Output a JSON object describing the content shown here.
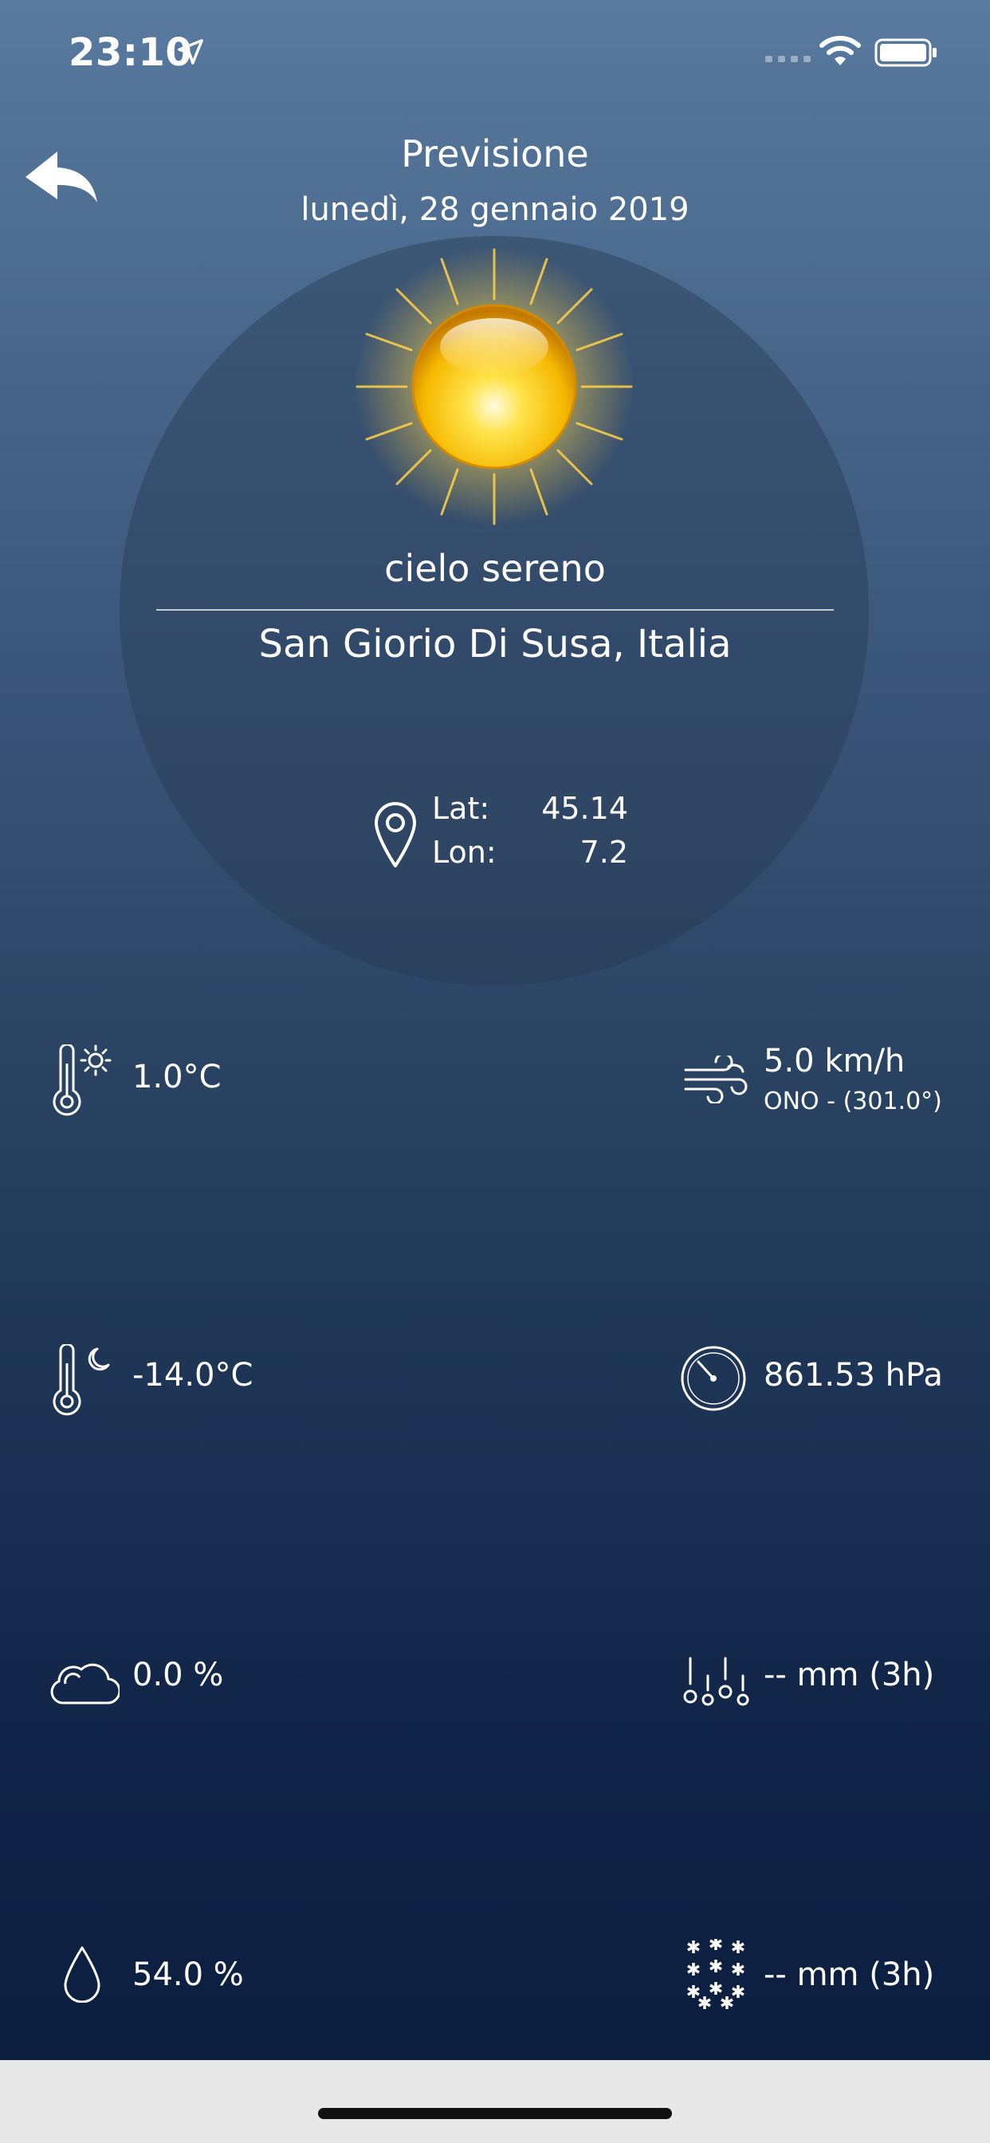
{
  "status_bar": {
    "time": "23:10"
  },
  "header": {
    "title": "Previsione",
    "date": "lunedì, 28 gennaio 2019"
  },
  "weather": {
    "condition": "cielo sereno",
    "location": "San Giorio Di Susa, Italia",
    "lat_label": "Lat:",
    "lat_value": "45.14",
    "lon_label": "Lon:",
    "lon_value": "7.2"
  },
  "metrics": {
    "temp_max": "1.0°C",
    "temp_min": "-14.0°C",
    "clouds": "0.0 %",
    "humidity": "54.0 %",
    "wind_speed": "5.0 km/h",
    "wind_dir": "ONO - (301.0°)",
    "pressure": "861.53 hPa",
    "rain": "-- mm (3h)",
    "snow": "-- mm (3h)"
  }
}
